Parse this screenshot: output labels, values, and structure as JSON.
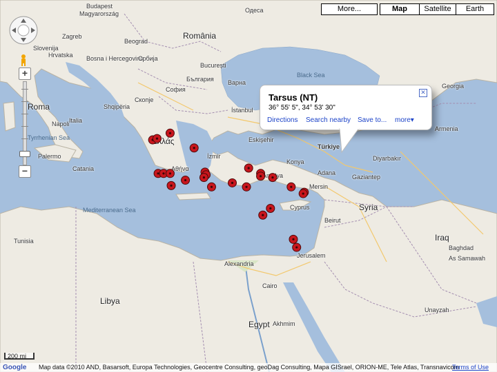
{
  "controls": {
    "more": "More...",
    "map": "Map",
    "satellite": "Satellite",
    "earth": "Earth",
    "zoom_in": "+",
    "zoom_out": "−"
  },
  "popup": {
    "title": "Tarsus (NT)",
    "coords": "36° 55' 5\", 34° 53' 30\"",
    "links": [
      "Directions",
      "Search nearby",
      "Save to...",
      "more▾"
    ],
    "close": "✕"
  },
  "scale": {
    "label": "200 mi"
  },
  "footer": {
    "logo": "Google",
    "attribution": "Map data ©2010 AND, Basarsoft, Europa Technologies, Geocentre Consulting, geoDag Consulting, Mapa GISrael, ORION-ME, Tele Atlas, Transnavicom",
    "terms": "Terms of Use"
  },
  "labels": {
    "budapest": "Budapest",
    "hungary": "Magyarország",
    "slovenija": "Slovenija",
    "zagreb": "Zagreb",
    "croatia": "Hrvatska",
    "beograd": "Beograd",
    "bosnia": "Bosna i Hercegovina",
    "serbia": "Србија",
    "romania": "România",
    "bucuresti": "București",
    "sofia": "София",
    "bulgaria": "България",
    "odessa": "Одеса",
    "varna": "Варна",
    "skopje": "Скопје",
    "albania": "Shqipëria",
    "roma": "Roma",
    "napoli": "Napoli",
    "tyrrhenian": "Tyrrhenian Sea",
    "palermo": "Palermo",
    "italia": "Italia",
    "catania": "Catania",
    "ellas": "Ελλάς",
    "athina": "Αθήνα",
    "istanbul": "İstanbul",
    "izmir": "İzmir",
    "eskisehir": "Eskişehir",
    "turkiye": "Türkiye",
    "ankara": "Ankara",
    "antalya": "Antalya",
    "adana": "Adana",
    "mersin": "Mersin",
    "konya": "Konya",
    "diyarbakir": "Diyarbakır",
    "gaziantep": "Gaziantep",
    "black_sea": "Black Sea",
    "med_sea": "Mediterranean Sea",
    "cyprus": "Cyprus",
    "syria": "Syria",
    "iraq": "Iraq",
    "beirut": "Beirut",
    "jerusalem": "Jerusalem",
    "alexandria": "Alexandria",
    "cairo": "Cairo",
    "egypt": "Egypt",
    "libya": "Libya",
    "tunisia": "Tunisia",
    "armenia": "Armenia",
    "georgia": "Georgia",
    "akhmim": "Akhmim",
    "baghdad": "Baghdad",
    "as_samawah": "As Samawah",
    "unayzah": "Unayzah"
  },
  "markers": [
    {
      "lon": 22.2,
      "lat": 40.4
    },
    {
      "lon": 22.6,
      "lat": 40.5
    },
    {
      "lon": 23.8,
      "lat": 40.9
    },
    {
      "lon": 26.0,
      "lat": 39.8
    },
    {
      "lon": 22.7,
      "lat": 37.9
    },
    {
      "lon": 23.2,
      "lat": 37.9
    },
    {
      "lon": 23.8,
      "lat": 37.9
    },
    {
      "lon": 27.0,
      "lat": 38.0
    },
    {
      "lon": 27.1,
      "lat": 37.8
    },
    {
      "lon": 26.9,
      "lat": 37.6
    },
    {
      "lon": 27.6,
      "lat": 36.9
    },
    {
      "lon": 29.5,
      "lat": 37.2
    },
    {
      "lon": 31.0,
      "lat": 38.3
    },
    {
      "lon": 32.1,
      "lat": 37.9
    },
    {
      "lon": 32.1,
      "lat": 37.7
    },
    {
      "lon": 33.2,
      "lat": 37.6
    },
    {
      "lon": 30.8,
      "lat": 36.9
    },
    {
      "lon": 34.9,
      "lat": 36.9
    },
    {
      "lon": 36.1,
      "lat": 36.5
    },
    {
      "lon": 36.0,
      "lat": 36.4
    },
    {
      "lon": 33.0,
      "lat": 35.3
    },
    {
      "lon": 32.3,
      "lat": 34.8
    },
    {
      "lon": 35.1,
      "lat": 33.0
    },
    {
      "lon": 35.4,
      "lat": 32.4
    },
    {
      "lon": 25.2,
      "lat": 37.4
    },
    {
      "lon": 23.9,
      "lat": 37.0
    }
  ]
}
